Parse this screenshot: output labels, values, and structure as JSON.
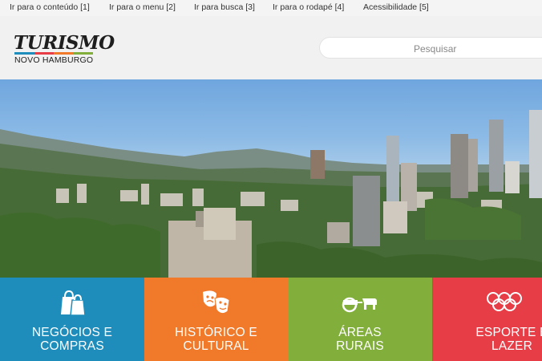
{
  "skip_links": [
    {
      "label": "Ir para o conteúdo [1]"
    },
    {
      "label": "Ir para o menu [2]"
    },
    {
      "label": "Ir para busca [3]"
    },
    {
      "label": "Ir para o rodapé [4]"
    },
    {
      "label": "Acessibilidade [5]"
    }
  ],
  "logo": {
    "title": "TURISMO",
    "subtitle": "NOVO HAMBURGO",
    "stripe_colors": [
      "#1f8dbb",
      "#e63d46",
      "#f0792a",
      "#82ae3c"
    ]
  },
  "search": {
    "placeholder": "Pesquisar"
  },
  "hero": {
    "image": "Novo Hamburgo city skyline photo"
  },
  "tiles": [
    {
      "line1": "NEGÓCIOS E",
      "line2": "COMPRAS",
      "icon": "shopping-bags-icon",
      "color": "#1f8dbb"
    },
    {
      "line1": "HISTÓRICO E",
      "line2": "CULTURAL",
      "icon": "theater-masks-icon",
      "color": "#f0792a"
    },
    {
      "line1": "ÁREAS",
      "line2": "RURAIS",
      "icon": "cart-and-cow-icon",
      "color": "#82ae3c"
    },
    {
      "line1": "ESPORTE E",
      "line2": "LAZER",
      "icon": "olympic-rings-icon",
      "color": "#e63d46"
    }
  ]
}
